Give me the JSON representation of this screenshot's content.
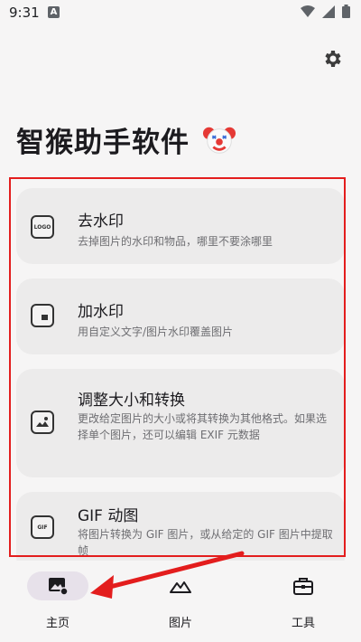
{
  "status_bar": {
    "time": "9:31",
    "notification_badge": "A",
    "icons": [
      "wifi-icon",
      "signal-icon",
      "battery-icon"
    ]
  },
  "header": {
    "settings_icon": "gear-icon",
    "app_title": "智猴助手软件",
    "title_emoji": "clown-face-icon"
  },
  "tools": [
    {
      "icon": "watermark-remove-icon",
      "icon_text": "LOGO",
      "title": "去水印",
      "description": "去掉图片的水印和物品，哪里不要涂哪里"
    },
    {
      "icon": "watermark-add-icon",
      "icon_text": "",
      "title": "加水印",
      "description": "用自定义文字/图片水印覆盖图片"
    },
    {
      "icon": "resize-convert-icon",
      "icon_text": "",
      "title": "调整大小和转换",
      "description": "更改给定图片的大小或将其转换为其他格式。如果选择单个图片，还可以编辑 EXIF 元数据"
    },
    {
      "icon": "gif-icon",
      "icon_text": "GIF",
      "title": "GIF 动图",
      "description": "将图片转换为 GIF 图片，或从给定的 GIF 图片中提取帧"
    }
  ],
  "bottom_nav": [
    {
      "label": "主页",
      "icon": "home-image-icon",
      "active": true
    },
    {
      "label": "图片",
      "icon": "mountain-image-icon",
      "active": false
    },
    {
      "label": "工具",
      "icon": "toolbox-icon",
      "active": false
    }
  ],
  "colors": {
    "annotation_red": "#e31d1d",
    "card_background": "#ecebeb",
    "page_background": "#f6f5f5",
    "nav_active_pill": "#e7e1ea"
  }
}
